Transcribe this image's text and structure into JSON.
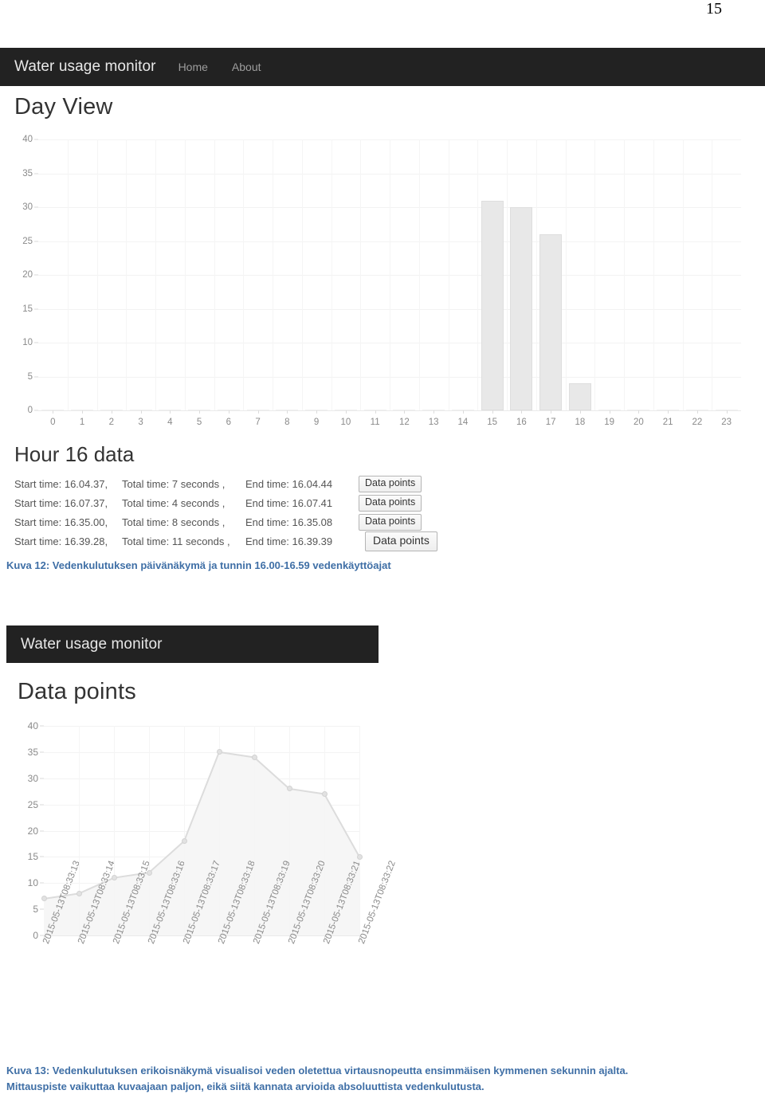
{
  "page": {
    "number": "15"
  },
  "shot1": {
    "navbar": {
      "brand": "Water usage monitor",
      "links": [
        {
          "label": "Home"
        },
        {
          "label": "About"
        }
      ]
    },
    "day_view": {
      "title": "Day View"
    },
    "hour_data": {
      "title": "Hour 16 data",
      "label_start": "Start time:",
      "label_total": "Total time:",
      "label_end": "End time:",
      "button_label": "Data points",
      "rows": [
        {
          "start": "16.04.37,",
          "total": "7 seconds ,",
          "end": "16.04.44"
        },
        {
          "start": "16.07.37,",
          "total": "4 seconds ,",
          "end": "16.07.41"
        },
        {
          "start": "16.35.00,",
          "total": "8 seconds ,",
          "end": "16.35.08"
        },
        {
          "start": "16.39.28,",
          "total": "11 seconds ,",
          "end": "16.39.39"
        }
      ]
    }
  },
  "caption12": "Kuva 12: Vedenkulutuksen päivänäkymä ja tunnin 16.00-16.59 vedenkäyttöajat",
  "shot2": {
    "navbar": {
      "brand": "Water usage monitor"
    },
    "data_points": {
      "title": "Data points"
    }
  },
  "caption13_line1": "Kuva 13: Vedenkulutuksen erikoisnäkymä visualisoi veden oletettua virtausnopeutta ensimmäisen kymmenen sekunnin ajalta.",
  "caption13_line2": "Mittauspiste vaikuttaa kuvaajaan paljon, eikä siitä kannata arvioida absoluuttista vedenkulutusta.",
  "colors": {
    "navbar_bg": "#222222",
    "brand_text": "#e8e8e8",
    "nav_link": "#9d9d9d",
    "bar_fill": "#e8e8e8",
    "bar_stroke": "#dedede",
    "grid": "#f3f3f3",
    "tick_text": "#8a8a8a",
    "caption_text": "#3f6fa6"
  },
  "chart_data": [
    {
      "type": "bar",
      "title": "Day View",
      "xlabel": "",
      "ylabel": "",
      "ylim": [
        0,
        40
      ],
      "yticks": [
        0,
        5,
        10,
        15,
        20,
        25,
        30,
        35,
        40
      ],
      "grid": true,
      "legend": "none",
      "categories": [
        "0",
        "1",
        "2",
        "3",
        "4",
        "5",
        "6",
        "7",
        "8",
        "9",
        "10",
        "11",
        "12",
        "13",
        "14",
        "15",
        "16",
        "17",
        "18",
        "19",
        "20",
        "21",
        "22",
        "23"
      ],
      "values": [
        0,
        0,
        0,
        0,
        0,
        0,
        0,
        0,
        0,
        0,
        0,
        0,
        0,
        0,
        0,
        31,
        30,
        26,
        4,
        0,
        0,
        0,
        0,
        0
      ]
    },
    {
      "type": "area",
      "title": "Data points",
      "xlabel": "",
      "ylabel": "",
      "ylim": [
        0,
        40
      ],
      "yticks": [
        0,
        5,
        10,
        15,
        20,
        25,
        30,
        35,
        40
      ],
      "grid": true,
      "legend": "none",
      "categories": [
        "2015-05-13T08:33:13",
        "2015-05-13T08:33:14",
        "2015-05-13T08:33:15",
        "2015-05-13T08:33:16",
        "2015-05-13T08:33:17",
        "2015-05-13T08:33:18",
        "2015-05-13T08:33:19",
        "2015-05-13T08:33:20",
        "2015-05-13T08:33:21",
        "2015-05-13T08:33:22"
      ],
      "values": [
        7,
        8,
        11,
        12,
        18,
        35,
        34,
        28,
        27,
        15
      ]
    }
  ]
}
